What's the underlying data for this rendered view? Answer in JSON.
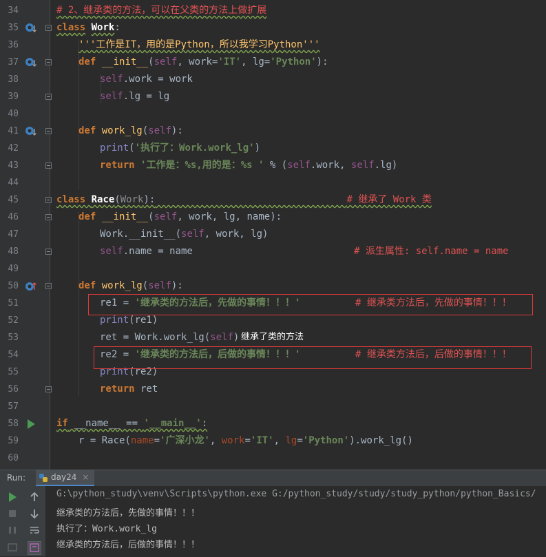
{
  "editor": {
    "line_numbers": [
      "34",
      "35",
      "36",
      "37",
      "38",
      "39",
      "40",
      "41",
      "42",
      "43",
      "44",
      "45",
      "46",
      "47",
      "48",
      "49",
      "50",
      "51",
      "52",
      "53",
      "54",
      "55",
      "56",
      "57",
      "58",
      "59",
      "60"
    ],
    "l34": {
      "comment": "# 2、继承类的方法，可以在父类的方法上做扩展"
    },
    "l35": {
      "kw": "class",
      "name": "Work",
      "colon": ":"
    },
    "l36": {
      "doc": "'''工作是IT，用的是Python，所以我学习Python'''"
    },
    "l37": {
      "kw": "def",
      "fn": "__init__",
      "p1": "(",
      "self": "self",
      "p2": ", work=",
      "s1": "'IT'",
      "p3": ", lg=",
      "s2": "'Python'",
      "p4": "):"
    },
    "l38": {
      "self": "self",
      "rest": ".work = work"
    },
    "l39": {
      "self": "self",
      "rest": ".lg = lg"
    },
    "l41": {
      "kw": "def",
      "fn": "work_lg",
      "p1": "(",
      "self": "self",
      "p2": "):"
    },
    "l42": {
      "bi": "print",
      "p1": "(",
      "str": "'执行了：Work.work_lg'",
      "p2": ")"
    },
    "l43": {
      "kw": "return",
      "str": "'工作是：%s,用的是：%s '",
      "p1": " % (",
      "self1": "self",
      "p2": ".work, ",
      "self2": "self",
      "p3": ".lg)"
    },
    "l45": {
      "kw": "class",
      "name": "Race",
      "p1": "(",
      "base": "Work",
      "p2": "):",
      "comment": "# 继承了 Work 类"
    },
    "l46": {
      "kw": "def",
      "fn": "__init__",
      "p1": "(",
      "self": "self",
      "p2": ", work, lg, name):"
    },
    "l47": {
      "p1": "Work.__init__(",
      "self": "self",
      "p2": ", work, lg)"
    },
    "l48": {
      "self": "self",
      "rest": ".name = name",
      "comment": "# 派生属性: self.name = name"
    },
    "l50": {
      "kw": "def",
      "fn": "work_lg",
      "p1": "(",
      "self": "self",
      "p2": "):"
    },
    "l51": {
      "p1": "re1 = ",
      "str": "'继承类的方法后，先做的事情！！！'",
      "comment": "# 继承类方法后，先做的事情！！！"
    },
    "l52": {
      "bi": "print",
      "p1": "(re1)"
    },
    "l53": {
      "p1": "ret = Work.work_lg(",
      "self": "self",
      "p2": ")"
    },
    "l54": {
      "p1": "re2 = ",
      "str": "'继承类的方法后，后做的事情！！！'",
      "comment": "# 继承类方法后，后做的事情！！！"
    },
    "l55": {
      "bi": "print",
      "p1": "(re2)"
    },
    "l56": {
      "kw": "return",
      "p1": " ret"
    },
    "l58": {
      "kw": "if",
      "p1": " __name__ == ",
      "str": "'__main__'",
      "p2": ":"
    },
    "l59": {
      "p1": "r = Race(",
      "k1": "name",
      "e1": "=",
      "s1": "'广深小龙'",
      "c1": ", ",
      "k2": "work",
      "e2": "=",
      "s2": "'IT'",
      "c2": ", ",
      "k3": "lg",
      "e3": "=",
      "s3": "'Python'",
      "p2": ").work_lg()"
    },
    "annotation": "继承了类的方法"
  },
  "run_panel": {
    "label": "Run:",
    "tab_label": "day24",
    "tab_close": "×",
    "output": [
      "G:\\python_study\\venv\\Scripts\\python.exe G:/python_study/study/study_python/python_Basics/",
      "继承类的方法后，先做的事情！！！",
      "执行了：Work.work_lg",
      "继承类的方法后，后做的事情！！！"
    ]
  },
  "colors": {
    "keyword": "#cc7832",
    "string": "#6a8759",
    "comment": "#e05252",
    "self": "#94558d",
    "highlight_box": "#e03a3a"
  }
}
